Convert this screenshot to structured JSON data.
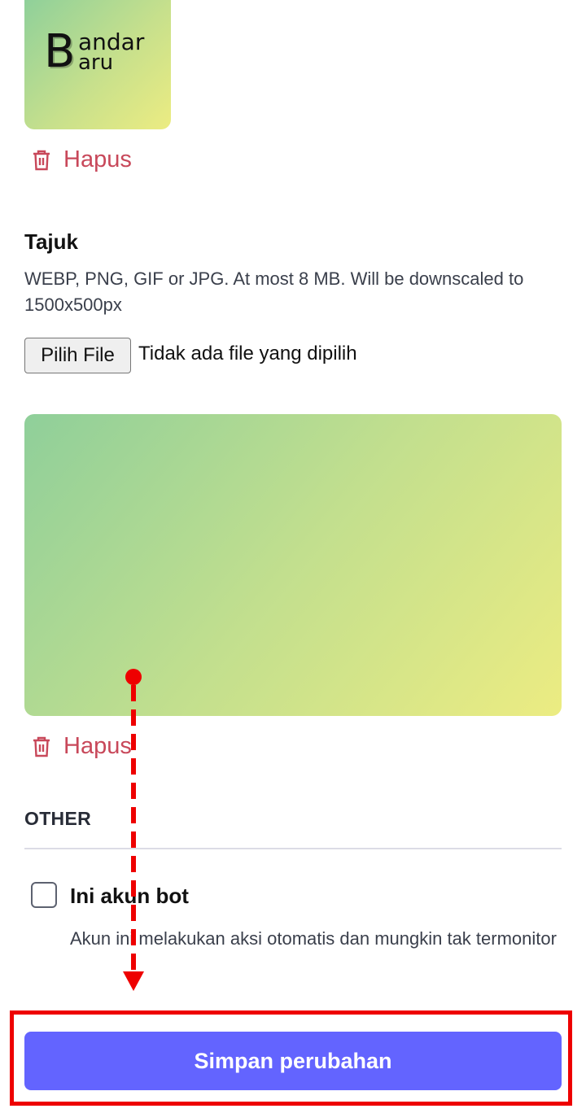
{
  "avatar": {
    "logo_initial": "B",
    "logo_line1": "andar",
    "logo_line2": "aru",
    "delete_label": "Hapus"
  },
  "header_field": {
    "title": "Tajuk",
    "hint": "WEBP, PNG, GIF or JPG. At most 8 MB. Will be downscaled to 1500x500px",
    "file_button_label": "Pilih File",
    "file_status": "Tidak ada file yang dipilih",
    "delete_label": "Hapus"
  },
  "other_section": {
    "title": "OTHER",
    "bot_checkbox": {
      "checked": false,
      "label": "Ini akun bot",
      "hint": "Akun ini melakukan aksi otomatis dan mungkin tak termonitor"
    }
  },
  "save_button_label": "Simpan perubahan",
  "colors": {
    "accent": "#6364ff",
    "danger": "#c8485a",
    "annotation": "#ee0000"
  },
  "icons": {
    "delete": "trash-icon"
  }
}
